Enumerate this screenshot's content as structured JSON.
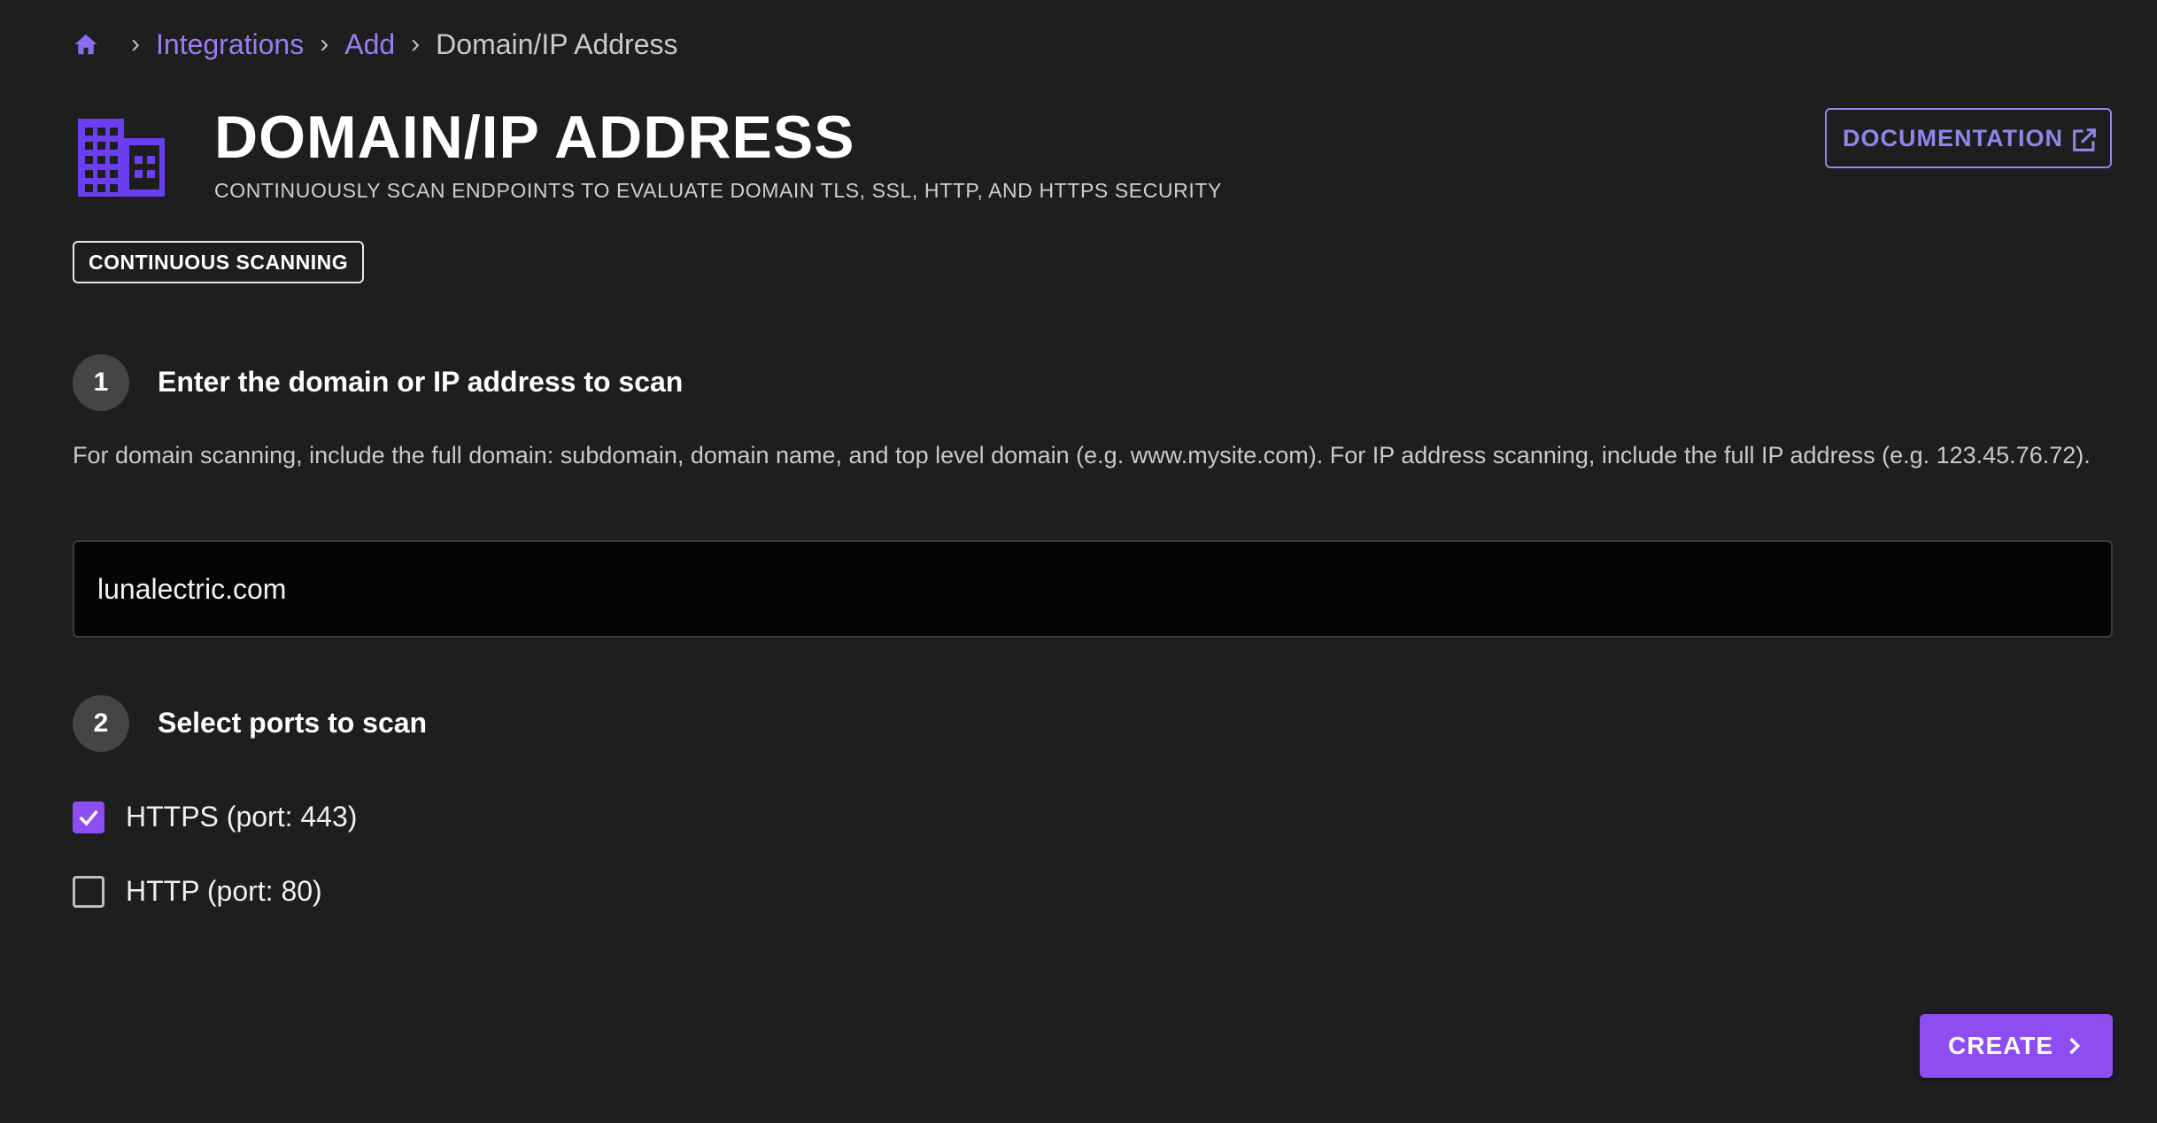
{
  "breadcrumb": {
    "home_icon": "home-icon",
    "items": [
      "Integrations",
      "Add"
    ],
    "current": "Domain/IP Address"
  },
  "header": {
    "icon": "building-icon",
    "title": "DOMAIN/IP ADDRESS",
    "subtitle": "CONTINUOUSLY SCAN ENDPOINTS TO EVALUATE DOMAIN TLS, SSL, HTTP, AND HTTPS SECURITY",
    "documentation_label": "DOCUMENTATION",
    "documentation_icon": "external-link-icon"
  },
  "badge": "CONTINUOUS SCANNING",
  "step1": {
    "number": "1",
    "title": "Enter the domain or IP address to scan",
    "help": "For domain scanning, include the full domain: subdomain, domain name, and top level domain (e.g. www.mysite.com). For IP address scanning, include the full IP address (e.g. 123.45.76.72).",
    "input_value": "lunalectric.com"
  },
  "step2": {
    "number": "2",
    "title": "Select ports to scan",
    "ports": [
      {
        "label": "HTTPS (port: 443)",
        "checked": true
      },
      {
        "label": "HTTP (port: 80)",
        "checked": false
      }
    ]
  },
  "create_label": "CREATE",
  "colors": {
    "background": "#1f1e1e",
    "accent": "#8e4df0",
    "link": "#9a7cf2",
    "doc_border": "#8f86ea",
    "icon": "#6b3ff0"
  }
}
